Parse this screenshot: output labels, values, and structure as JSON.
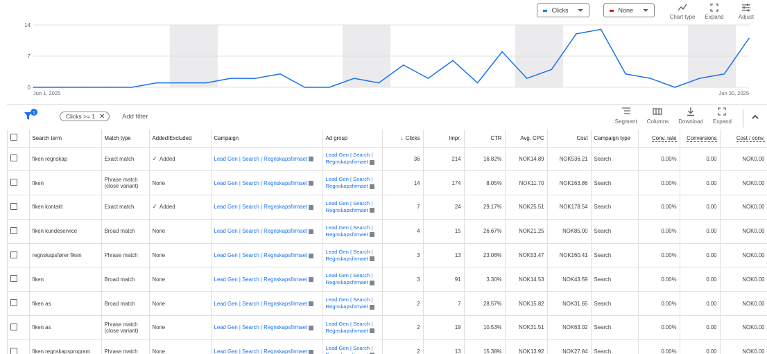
{
  "chart": {
    "metric1": {
      "label": "Clicks",
      "color": "#1a73e8"
    },
    "metric2": {
      "label": "None",
      "color": "#c5221f"
    },
    "controls": [
      {
        "name": "chart-type-button",
        "icon": "chart-type-icon",
        "label": "Chart type"
      },
      {
        "name": "expand-chart-button",
        "icon": "expand-icon",
        "label": "Expand"
      },
      {
        "name": "adjust-chart-button",
        "icon": "adjust-icon",
        "label": "Adjust"
      }
    ],
    "y_ticks": [
      "14",
      "7",
      "0"
    ],
    "x_start": "Jun 1, 2025",
    "x_end": "Jun 30, 2025"
  },
  "chart_data": {
    "type": "line",
    "x": [
      "Jun 1",
      "Jun 2",
      "Jun 3",
      "Jun 4",
      "Jun 5",
      "Jun 6",
      "Jun 7",
      "Jun 8",
      "Jun 9",
      "Jun 10",
      "Jun 11",
      "Jun 12",
      "Jun 13",
      "Jun 14",
      "Jun 15",
      "Jun 16",
      "Jun 17",
      "Jun 18",
      "Jun 19",
      "Jun 20",
      "Jun 21",
      "Jun 22",
      "Jun 23",
      "Jun 24",
      "Jun 25",
      "Jun 26",
      "Jun 27",
      "Jun 28",
      "Jun 29",
      "Jun 30"
    ],
    "series": [
      {
        "name": "Clicks",
        "values": [
          0,
          0,
          0,
          0,
          0,
          1,
          1,
          1,
          2,
          2,
          3,
          0,
          0,
          2,
          1,
          5,
          2,
          6,
          1,
          8,
          2,
          4,
          12,
          13,
          3,
          2,
          0,
          2,
          3,
          11
        ]
      }
    ],
    "ylim": [
      0,
      14
    ],
    "shaded_weekends": [
      [
        6,
        7
      ],
      [
        13,
        14
      ],
      [
        20,
        21
      ],
      [
        27,
        28
      ]
    ],
    "grid": true
  },
  "filters": {
    "chip": "Clicks >= 1",
    "add_filter": "Add filter",
    "badge": "1"
  },
  "toolbar": [
    {
      "name": "segment-button",
      "icon": "segment-icon",
      "label": "Segment"
    },
    {
      "name": "columns-button",
      "icon": "columns-icon",
      "label": "Columns"
    },
    {
      "name": "download-button",
      "icon": "download-icon",
      "label": "Download"
    },
    {
      "name": "expand-table-button",
      "icon": "expand-icon",
      "label": "Expand"
    }
  ],
  "table": {
    "headers": [
      "Search term",
      "Match type",
      "Added/Excluded",
      "Campaign",
      "Ad group",
      "Clicks",
      "Impr.",
      "CTR",
      "Avg. CPC",
      "Cost",
      "Campaign type",
      "Conv. rate",
      "Conversions",
      "Cost / conv."
    ],
    "rows": [
      {
        "term": "fiken regnskap",
        "match": "Exact match",
        "added": "Added",
        "campaign": "Lead Gen | Search | Regnskapsfirmaet",
        "adgroup": "Lead Gen | Search | Regnskapsfirmaet",
        "clicks": "36",
        "impr": "214",
        "ctr": "16.82%",
        "cpc": "NOK14.89",
        "cost": "NOK536.21",
        "type": "Search",
        "convrate": "0.00%",
        "conv": "0.00",
        "costconv": "NOK0.00"
      },
      {
        "term": "fiken",
        "match": "Phrase match (close variant)",
        "added": "None",
        "campaign": "Lead Gen | Search | Regnskapsfirmaet",
        "adgroup": "Lead Gen | Search | Regnskapsfirmaet",
        "clicks": "14",
        "impr": "174",
        "ctr": "8.05%",
        "cpc": "NOK11.70",
        "cost": "NOK163.86",
        "type": "Search",
        "convrate": "0.00%",
        "conv": "0.00",
        "costconv": "NOK0.00"
      },
      {
        "term": "fiken kontakt",
        "match": "Exact match",
        "added": "Added",
        "campaign": "Lead Gen | Search | Regnskapsfirmaet",
        "adgroup": "Lead Gen | Search | Regnskapsfirmaet",
        "clicks": "7",
        "impr": "24",
        "ctr": "29.17%",
        "cpc": "NOK25.51",
        "cost": "NOK178.54",
        "type": "Search",
        "convrate": "0.00%",
        "conv": "0.00",
        "costconv": "NOK0.00"
      },
      {
        "term": "fiken kundeservice",
        "match": "Broad match",
        "added": "None",
        "campaign": "Lead Gen | Search | Regnskapsfirmaet",
        "adgroup": "Lead Gen | Search | Regnskapsfirmaet",
        "clicks": "4",
        "impr": "15",
        "ctr": "26.67%",
        "cpc": "NOK21.25",
        "cost": "NOK85.00",
        "type": "Search",
        "convrate": "0.00%",
        "conv": "0.00",
        "costconv": "NOK0.00"
      },
      {
        "term": "regnskapsfører fiken",
        "match": "Phrase match",
        "added": "None",
        "campaign": "Lead Gen | Search | Regnskapsfirmaet",
        "adgroup": "Lead Gen | Search | Regnskapsfirmaet",
        "clicks": "3",
        "impr": "13",
        "ctr": "23.08%",
        "cpc": "NOK53.47",
        "cost": "NOK160.41",
        "type": "Search",
        "convrate": "0.00%",
        "conv": "0.00",
        "costconv": "NOK0.00"
      },
      {
        "term": "fiken",
        "match": "Broad match",
        "added": "None",
        "campaign": "Lead Gen | Search | Regnskapsfirmaet",
        "adgroup": "Lead Gen | Search | Regnskapsfirmaet",
        "clicks": "3",
        "impr": "91",
        "ctr": "3.30%",
        "cpc": "NOK14.53",
        "cost": "NOK43.59",
        "type": "Search",
        "convrate": "0.00%",
        "conv": "0.00",
        "costconv": "NOK0.00"
      },
      {
        "term": "fiken as",
        "match": "Broad match",
        "added": "None",
        "campaign": "Lead Gen | Search | Regnskapsfirmaet",
        "adgroup": "Lead Gen | Search | Regnskapsfirmaet",
        "clicks": "2",
        "impr": "7",
        "ctr": "28.57%",
        "cpc": "NOK15.82",
        "cost": "NOK31.65",
        "type": "Search",
        "convrate": "0.00%",
        "conv": "0.00",
        "costconv": "NOK0.00"
      },
      {
        "term": "fiken as",
        "match": "Phrase match (close variant)",
        "added": "None",
        "campaign": "Lead Gen | Search | Regnskapsfirmaet",
        "adgroup": "Lead Gen | Search | Regnskapsfirmaet",
        "clicks": "2",
        "impr": "19",
        "ctr": "10.53%",
        "cpc": "NOK31.51",
        "cost": "NOK63.02",
        "type": "Search",
        "convrate": "0.00%",
        "conv": "0.00",
        "costconv": "NOK0.00"
      },
      {
        "term": "fiken regnskapsprogram",
        "match": "Phrase match",
        "added": "None",
        "campaign": "Lead Gen | Search | Regnskapsfirmaet",
        "adgroup": "Lead Gen | Search | Regnskapsfirmaet",
        "clicks": "2",
        "impr": "13",
        "ctr": "15.38%",
        "cpc": "NOK13.92",
        "cost": "NOK27.84",
        "type": "Search",
        "convrate": "0.00%",
        "conv": "0.00",
        "costconv": "NOK0.00"
      }
    ]
  }
}
